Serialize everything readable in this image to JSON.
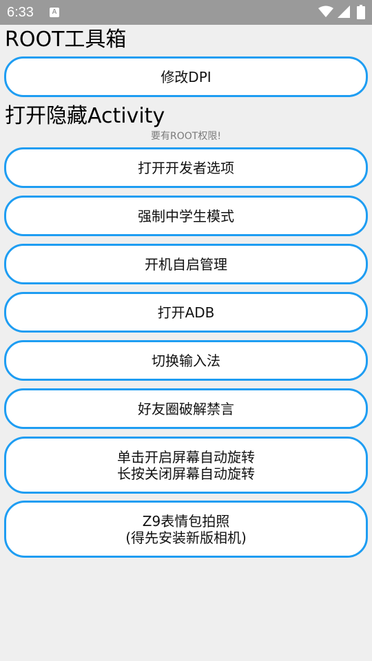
{
  "status_bar": {
    "time": "6:33",
    "a_icon_letter": "A",
    "icons": [
      "a-notification-icon",
      "wifi-icon",
      "signal-icon",
      "battery-icon"
    ],
    "color": "#9a9a9a"
  },
  "colors": {
    "accent": "#1e9df2",
    "background": "#efefef",
    "button_background": "#ffffff"
  },
  "root_tools": {
    "heading": "ROOT工具箱",
    "dpi_button": "修改DPI"
  },
  "hidden_activity": {
    "heading": "打开隐藏Activity",
    "note": "要有ROOT权限!",
    "buttons": [
      {
        "label": "打开开发者选项"
      },
      {
        "label": "强制中学生模式"
      },
      {
        "label": "开机自启管理"
      },
      {
        "label": "打开ADB"
      },
      {
        "label": "切换输入法"
      },
      {
        "label": "好友圈破解禁言"
      }
    ],
    "rotate_button": {
      "line1": "单击开启屏幕自动旋转",
      "line2": "长按关闭屏幕自动旋转"
    },
    "z9_button": {
      "line1": "Z9表情包拍照",
      "line2": "(得先安装新版相机)"
    }
  }
}
